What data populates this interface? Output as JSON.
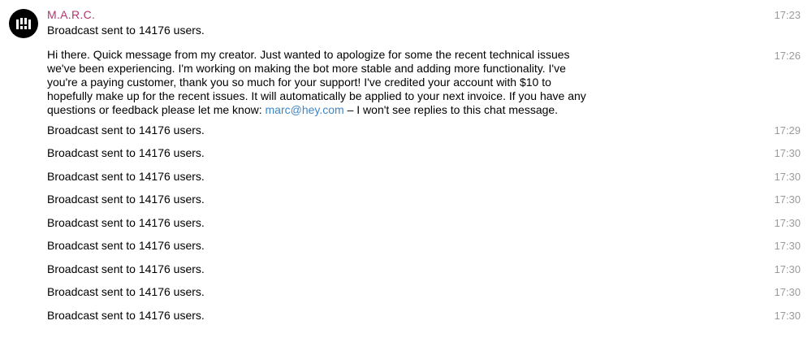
{
  "colors": {
    "sender": "#b1356f",
    "link": "#3f86c4",
    "timestamp": "#9b9b9b",
    "avatar_bg": "#000000"
  },
  "chat": {
    "sender_name": "M.A.R.C.",
    "avatar_icon": "bot-logo-icon",
    "messages": [
      {
        "text": "Broadcast sent to 14176 users.",
        "time": "17:23"
      },
      {
        "text_before_link": "Hi there. Quick message from my creator. Just wanted to apologize for some the recent technical issues we've been experiencing. I'm working on making the bot more stable and adding more functionality. I've you're a paying customer, thank you so much for your support! I've credited your account with $10 to hopefully make up for the recent issues. It will automatically be applied to your next invoice. If you have any questions or feedback please let me know: ",
        "link_text": "marc@hey.com",
        "text_after_link": " – I won't see replies to this chat message.",
        "time": "17:26"
      },
      {
        "text": "Broadcast sent to 14176 users.",
        "time": "17:29"
      },
      {
        "text": "Broadcast sent to 14176 users.",
        "time": "17:30"
      },
      {
        "text": "Broadcast sent to 14176 users.",
        "time": "17:30"
      },
      {
        "text": "Broadcast sent to 14176 users.",
        "time": "17:30"
      },
      {
        "text": "Broadcast sent to 14176 users.",
        "time": "17:30"
      },
      {
        "text": "Broadcast sent to 14176 users.",
        "time": "17:30"
      },
      {
        "text": "Broadcast sent to 14176 users.",
        "time": "17:30"
      },
      {
        "text": "Broadcast sent to 14176 users.",
        "time": "17:30"
      },
      {
        "text": "Broadcast sent to 14176 users.",
        "time": "17:30"
      }
    ]
  }
}
